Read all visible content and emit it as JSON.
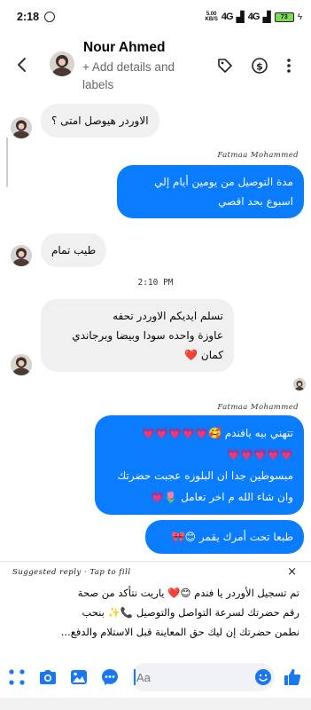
{
  "status_bar": {
    "time": "2:18",
    "net_speed_top": "5.00",
    "net_speed_bottom": "KB/S",
    "signal_1": "4G",
    "signal_2": "4G",
    "battery": "73"
  },
  "header": {
    "name": "Nour Ahmed",
    "subtitle": "+ Add details and labels",
    "icons": [
      "back-arrow-icon",
      "tag-icon",
      "dollar-icon",
      "more-options-icon"
    ]
  },
  "messages": [
    {
      "side": "in",
      "text": "الاوردر هيوصل امتى ؟"
    },
    {
      "side": "out",
      "sender": "Fatmaa Mohammed",
      "line1": "مدة التوصيل من يومين أيام  إلي",
      "line2": "اسبوع بحد اقصي"
    },
    {
      "side": "in",
      "text": "طيب تمام"
    },
    {
      "side": "in",
      "line1": "تسلم ايديكم الاوردر تحفه",
      "line2": "عاوزة واحده سودا وبيضا وبرجاندي",
      "line3": "كمان ❤️"
    },
    {
      "side": "out",
      "sender": "Fatmaa Mohammed",
      "line1": "تتهني بيه يافندم 🥰💗💗💗💗💗",
      "line2": "💗💗💗💗💗",
      "line3": "مبسوطين جدا ان البلوزه عجبت حضرتك",
      "line4": "وان شاء الله م اخر تعامل 🌷💗"
    },
    {
      "side": "out",
      "text": "طبعا تحت أمرك يقمر 😊🎀"
    }
  ],
  "timestamp": "2:10 PM",
  "suggested_reply": {
    "label": "Suggested reply · Tap to fill",
    "close": "×",
    "line1": "تم تسجيل الأوردر يا فندم 😊❤️ ياريت نتأكد من صحة",
    "line2": "رقم حضرتك لسرعة التواصل والتوصيل 📞✨ بنحب",
    "line3": "نطمن حضرتك إن ليك حق المعاينة قبل الاستلام والدفع..."
  },
  "composer": {
    "placeholder": "Aa",
    "icons": [
      "apps-grid-icon",
      "camera-icon",
      "gallery-icon",
      "chat-bubble-icon",
      "emoji-icon",
      "like-icon"
    ]
  },
  "colors": {
    "accent": "#0a7cff",
    "incoming": "#f0f0f0",
    "heart": "#e6283a"
  }
}
